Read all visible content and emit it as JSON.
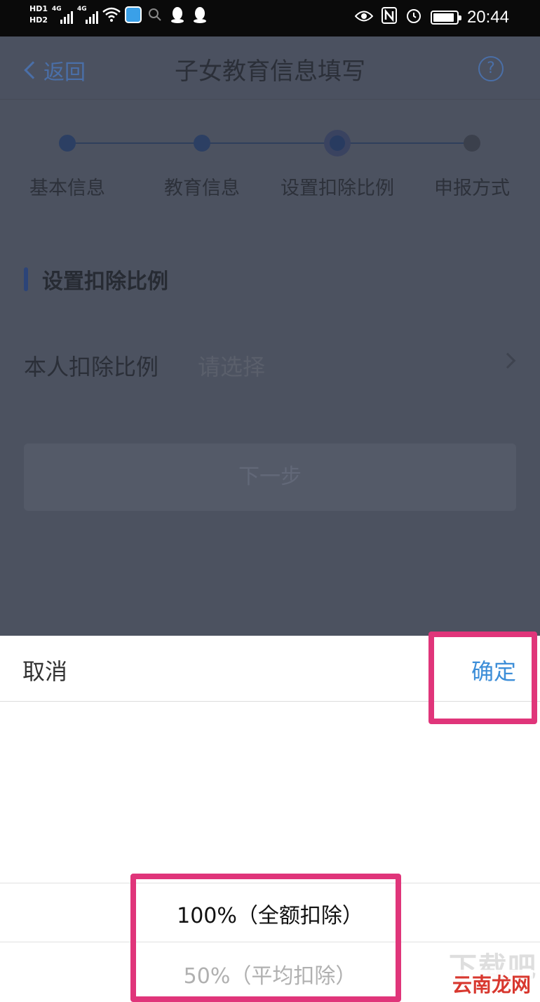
{
  "status_bar": {
    "hd1": "HD1",
    "hd2": "HD2",
    "net1": "4G",
    "net2": "4G",
    "time": "20:44",
    "battery_level": 0.9
  },
  "header": {
    "back_label": "返回",
    "title": "子女教育信息填写",
    "help_symbol": "?"
  },
  "steps": [
    {
      "label": "基本信息",
      "state": "done"
    },
    {
      "label": "教育信息",
      "state": "done"
    },
    {
      "label": "设置扣除比例",
      "state": "active"
    },
    {
      "label": "申报方式",
      "state": "pending"
    }
  ],
  "section": {
    "title": "设置扣除比例",
    "row_label": "本人扣除比例",
    "row_placeholder": "请选择",
    "next_label": "下一步"
  },
  "sheet": {
    "cancel_label": "取消",
    "confirm_label": "确定",
    "options": [
      "100%（全额扣除）",
      "50%（平均扣除）"
    ],
    "selected_index": 0
  },
  "watermark": {
    "main": "下载吧",
    "sub": "云南龙网"
  },
  "colors": {
    "overlay": "#4c5260",
    "accent": "#3d8ed8",
    "highlight": "#e0357a"
  }
}
